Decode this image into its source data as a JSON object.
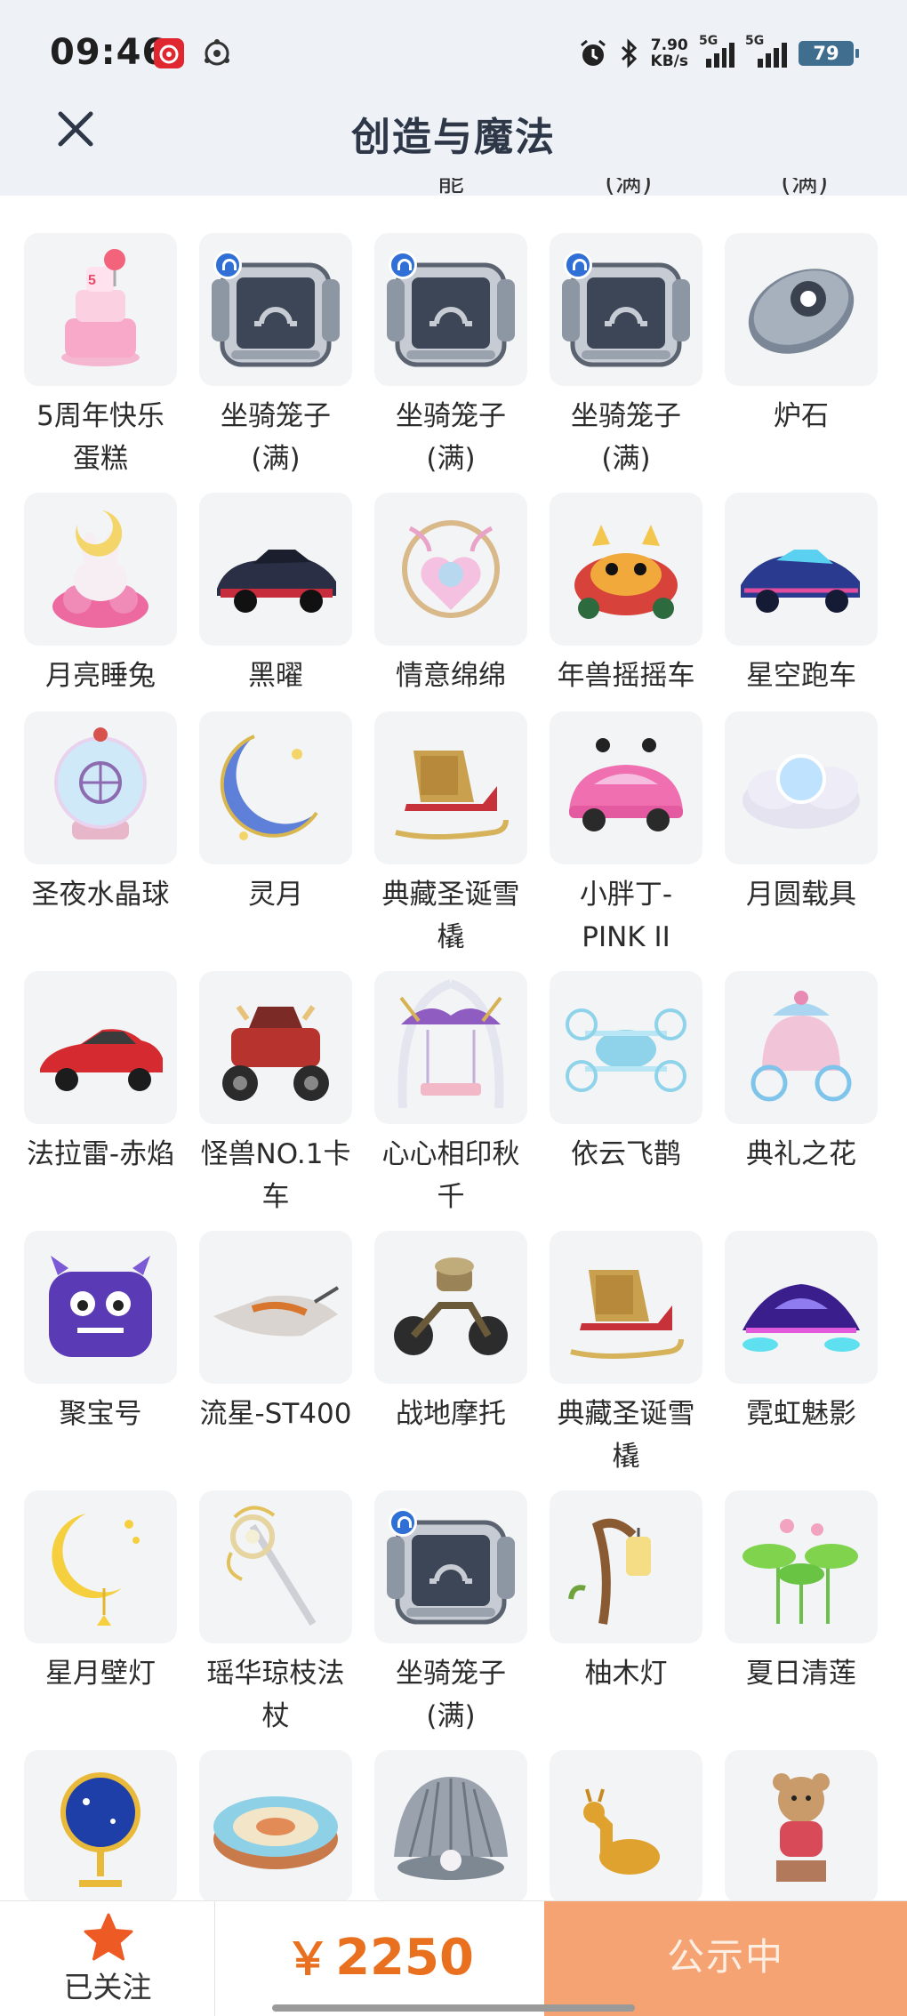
{
  "status_bar": {
    "time": "09:46",
    "speed_value": "7.90",
    "speed_unit": "KB/s",
    "sim1": "5G",
    "sim2": "5G",
    "battery": "79"
  },
  "header": {
    "title": "创造与魔法"
  },
  "partial_row_labels": [
    "能",
    "(满)",
    "(满)"
  ],
  "items": [
    {
      "name": "5周年快乐蛋糕",
      "icon": "birthday-cake",
      "badge": false
    },
    {
      "name": "坐骑笼子(满)",
      "icon": "mount-cage",
      "badge": true
    },
    {
      "name": "坐骑笼子(满)",
      "icon": "mount-cage",
      "badge": true
    },
    {
      "name": "坐骑笼子(满)",
      "icon": "mount-cage",
      "badge": true
    },
    {
      "name": "炉石",
      "icon": "hearthstone",
      "badge": false
    },
    {
      "name": "月亮睡兔",
      "icon": "moon-bunny",
      "badge": false
    },
    {
      "name": "黑曜",
      "icon": "dark-car",
      "badge": false
    },
    {
      "name": "情意绵绵",
      "icon": "heart-wreath",
      "badge": false
    },
    {
      "name": "年兽摇摇车",
      "icon": "beast-car",
      "badge": false
    },
    {
      "name": "星空跑车",
      "icon": "star-car",
      "badge": false
    },
    {
      "name": "圣夜水晶球",
      "icon": "crystal-ball",
      "badge": false
    },
    {
      "name": "灵月",
      "icon": "crescent-moon",
      "badge": false
    },
    {
      "name": "典藏圣诞雪橇",
      "icon": "sleigh",
      "badge": false
    },
    {
      "name": "小胖丁-PINK II",
      "icon": "pink-beetle",
      "badge": false
    },
    {
      "name": "月圆载具",
      "icon": "moon-cloud",
      "badge": false
    },
    {
      "name": "法拉雷-赤焰",
      "icon": "red-car",
      "badge": false
    },
    {
      "name": "怪兽NO.1卡车",
      "icon": "monster-truck",
      "badge": false
    },
    {
      "name": "心心相印秋千",
      "icon": "swing",
      "badge": false
    },
    {
      "name": "依云飞鹊",
      "icon": "drone",
      "badge": false
    },
    {
      "name": "典礼之花",
      "icon": "carriage",
      "badge": false
    },
    {
      "name": "聚宝号",
      "icon": "purple-monster",
      "badge": false
    },
    {
      "name": "流星-ST400",
      "icon": "jet-bike",
      "badge": false
    },
    {
      "name": "战地摩托",
      "icon": "motorbike",
      "badge": false
    },
    {
      "name": "典藏圣诞雪橇",
      "icon": "sleigh",
      "badge": false
    },
    {
      "name": "霓虹魅影",
      "icon": "neon-car",
      "badge": false
    },
    {
      "name": "星月壁灯",
      "icon": "moon-lamp",
      "badge": false
    },
    {
      "name": "瑶华琼枝法杖",
      "icon": "staff",
      "badge": false
    },
    {
      "name": "坐骑笼子(满)",
      "icon": "mount-cage",
      "badge": true
    },
    {
      "name": "柚木灯",
      "icon": "wood-lamp",
      "badge": false
    },
    {
      "name": "夏日清莲",
      "icon": "lotus",
      "badge": false
    },
    {
      "name": "",
      "icon": "globe",
      "badge": false
    },
    {
      "name": "",
      "icon": "drum",
      "badge": false
    },
    {
      "name": "",
      "icon": "shell",
      "badge": false
    },
    {
      "name": "",
      "icon": "deer",
      "badge": false
    },
    {
      "name": "",
      "icon": "teddy",
      "badge": false
    }
  ],
  "bottom_bar": {
    "follow_label": "已关注",
    "currency": "￥",
    "price": "2250",
    "status_button": "公示中"
  },
  "colors": {
    "accent_orange": "#e8701f",
    "status_button_bg": "#f6a373",
    "header_bg": "#eef2f7",
    "tile_bg": "#f3f4f6"
  }
}
